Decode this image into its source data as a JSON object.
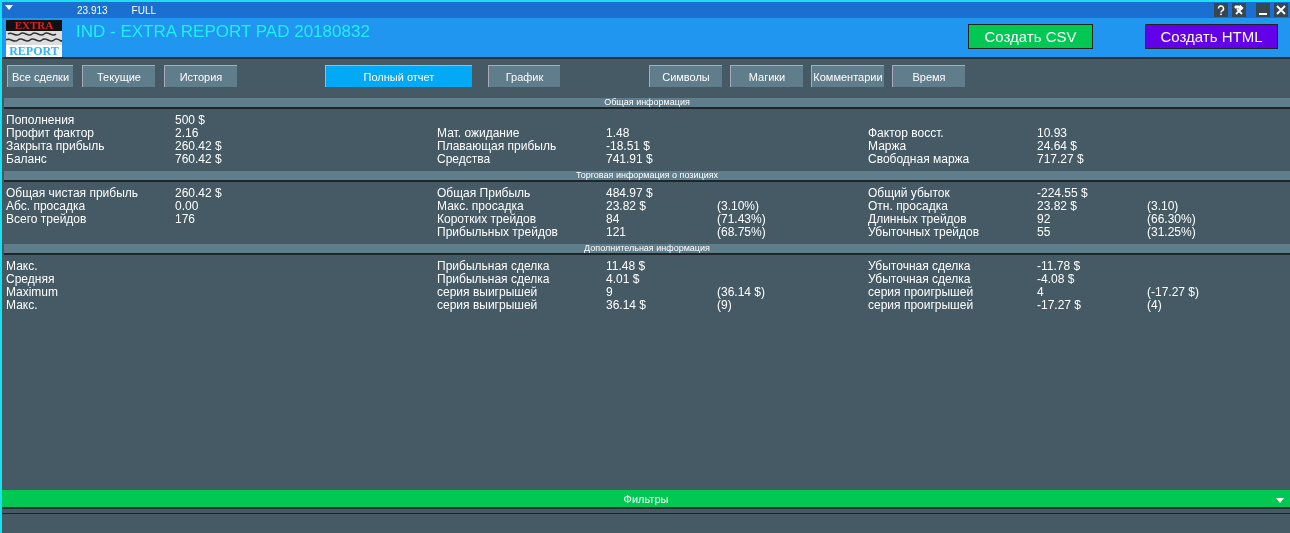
{
  "top_strip": {
    "value": "23.913",
    "mode": "FULL"
  },
  "logo": {
    "top": "EXTRA",
    "bottom": "REPORT"
  },
  "window": {
    "title": "IND - EXTRA REPORT PAD 20180832"
  },
  "header_buttons": [
    {
      "label": "Создать CSV",
      "kind": "csv"
    },
    {
      "label": "Создать HTML",
      "kind": "html"
    }
  ],
  "tab_groups": [
    {
      "tabs": [
        {
          "label": "Все сделки",
          "selected": false
        },
        {
          "label": "Текущие",
          "selected": false
        },
        {
          "label": "История",
          "selected": false
        }
      ]
    },
    {
      "tabs": [
        {
          "label": "Полный отчет",
          "selected": true
        },
        {
          "label": "График",
          "selected": false
        }
      ]
    },
    {
      "tabs": [
        {
          "label": "Символы",
          "selected": false
        },
        {
          "label": "Магики",
          "selected": false
        },
        {
          "label": "Комментарии",
          "selected": false
        },
        {
          "label": "Время",
          "selected": false
        }
      ]
    }
  ],
  "sections": [
    {
      "title": "Общая информация",
      "rows": [
        {
          "left": {
            "label": "Пополнения",
            "value": "500 $"
          }
        },
        {
          "left": {
            "label": "Профит фактор",
            "value": "2.16"
          },
          "middle": {
            "label": "Мат. ожидание",
            "value": "1.48"
          },
          "right": {
            "label": "Фактор восст.",
            "value": "10.93"
          }
        },
        {
          "left": {
            "label": "Закрыта прибыль",
            "value": "260.42 $"
          },
          "middle": {
            "label": "Плавающая прибыль",
            "value": "-18.51 $"
          },
          "right": {
            "label": "Маржа",
            "value": "24.64 $"
          }
        },
        {
          "left": {
            "label": "Баланс",
            "value": "760.42 $"
          },
          "middle": {
            "label": "Средства",
            "value": "741.91 $"
          },
          "right": {
            "label": "Свободная маржа",
            "value": "717.27 $"
          }
        }
      ]
    },
    {
      "title": "Торговая информация о позициях",
      "rows": [
        {
          "left": {
            "label": "Общая чистая прибыль",
            "value": "260.42 $"
          },
          "middle": {
            "label": "Общая Прибыль",
            "value": "484.97 $"
          },
          "right": {
            "label": "Общий убыток",
            "value": "-224.55 $"
          }
        },
        {
          "left": {
            "label": "Абс. просадка",
            "value": "0.00"
          },
          "middle": {
            "label": "Макс. просадка",
            "value": "23.82 $",
            "extra": "(3.10%)"
          },
          "right": {
            "label": "Отн. просадка",
            "value": "23.82 $",
            "extra": "(3.10)"
          }
        },
        {
          "left": {
            "label": "Всего трейдов",
            "value": "176"
          },
          "middle": {
            "label": "Коротких трейдов",
            "value": "84",
            "extra": "(71.43%)"
          },
          "right": {
            "label": "Длинных трейдов",
            "value": "92",
            "extra": "(66.30%)"
          }
        },
        {
          "middle": {
            "label": "Прибыльных трейдов",
            "value": "121",
            "extra": "(68.75%)"
          },
          "right": {
            "label": "Убыточных трейдов",
            "value": "55",
            "extra": "(31.25%)"
          }
        }
      ]
    },
    {
      "title": "Дополнительная информация",
      "rows": [
        {
          "left": {
            "label": "Макс."
          },
          "middle": {
            "label": "Прибыльная сделка",
            "value": "11.48 $"
          },
          "right": {
            "label": "Убыточная сделка",
            "value": "-11.78 $"
          }
        },
        {
          "left": {
            "label": "Средняя"
          },
          "middle": {
            "label": "Прибыльная сделка",
            "value": "4.01 $"
          },
          "right": {
            "label": "Убыточная сделка",
            "value": "-4.08 $"
          }
        },
        {
          "left": {
            "label": "Maximum"
          },
          "middle": {
            "label": "серия выигрышей",
            "value": "9",
            "extra": "(36.14 $)"
          },
          "right": {
            "label": "серия проигрышей",
            "value": "4",
            "extra": "(-17.27 $)"
          }
        },
        {
          "left": {
            "label": "Макс."
          },
          "middle": {
            "label": "серия выигрышей",
            "value": "36.14 $",
            "extra": "(9)"
          },
          "right": {
            "label": "серия проигрышей",
            "value": "-17.27 $",
            "extra": "(4)"
          }
        }
      ]
    }
  ],
  "filters": {
    "label": "Фильтры"
  }
}
